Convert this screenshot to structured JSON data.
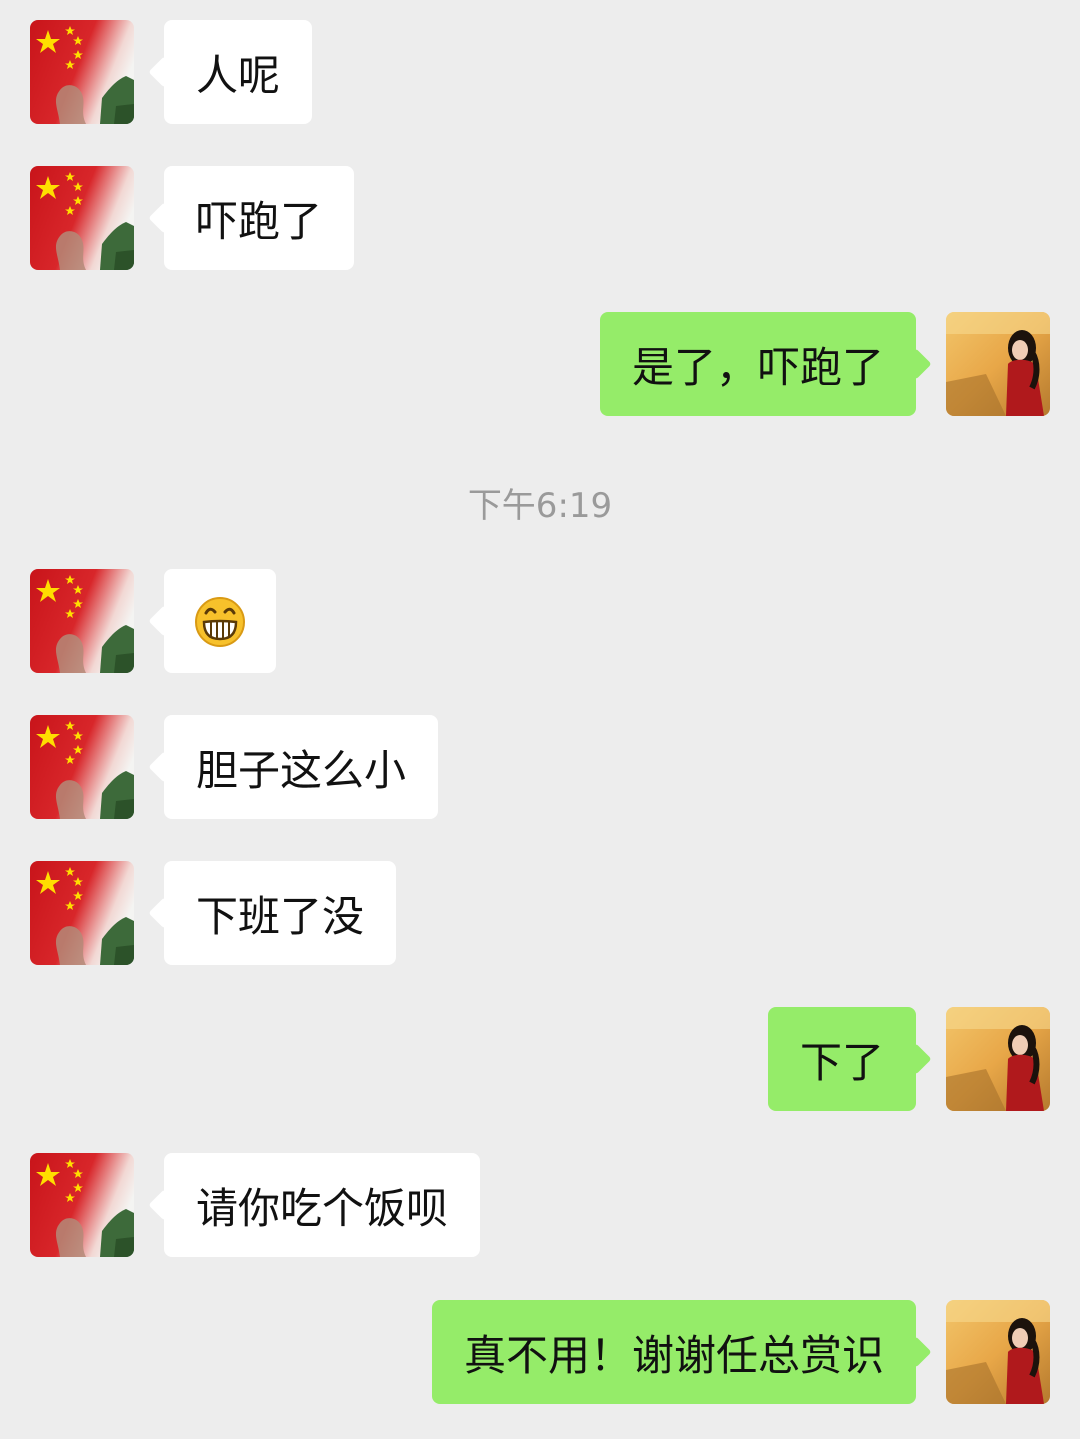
{
  "chat": {
    "timestamp": "下午6:19",
    "colors": {
      "background": "#ededed",
      "incoming_bubble": "#ffffff",
      "outgoing_bubble": "#95ec69",
      "timestamp_text": "#9a9a9a"
    },
    "messages": [
      {
        "side": "incoming",
        "text": "人呢"
      },
      {
        "side": "incoming",
        "text": "吓跑了"
      },
      {
        "side": "outgoing",
        "text": "是了，吓跑了"
      },
      {
        "side": "incoming",
        "emoji": "grinning-face-emoji"
      },
      {
        "side": "incoming",
        "text": "胆子这么小"
      },
      {
        "side": "incoming",
        "text": "下班了没"
      },
      {
        "side": "outgoing",
        "text": "下了"
      },
      {
        "side": "incoming",
        "text": "请你吃个饭呗"
      },
      {
        "side": "outgoing",
        "text": "真不用！谢谢任总赏识"
      }
    ],
    "avatars": {
      "incoming": "flag-avatar-icon",
      "outgoing": "user-photo-avatar-icon"
    }
  }
}
